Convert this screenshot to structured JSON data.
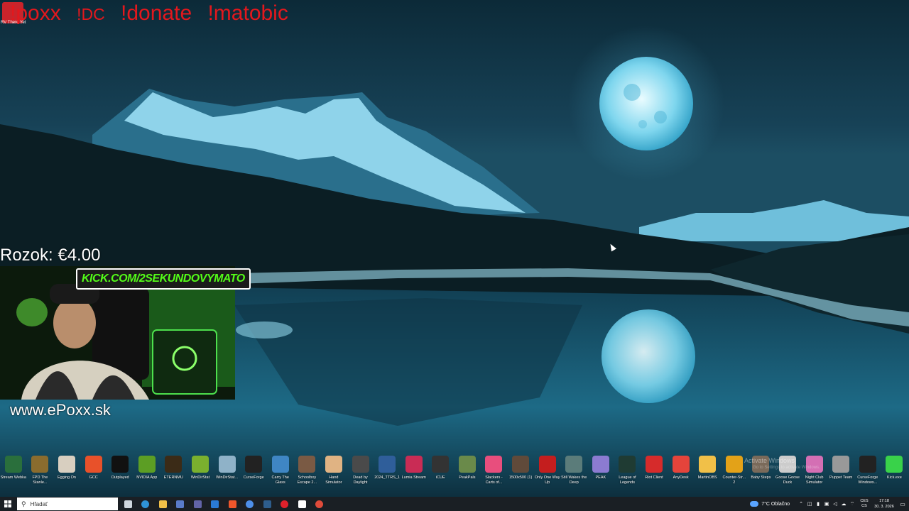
{
  "overlay": {
    "commands": [
      "!poxx",
      "!DC",
      "!donate",
      "!matobic"
    ],
    "app_caption": "RV There Yet",
    "donation": "Rozok: €4.00",
    "kick": "KICK.COM/2SEKUNDOVYMATO",
    "website": "www.ePoxx.sk"
  },
  "desktop_icons": [
    {
      "label": "Stream Webka",
      "color": "#2a6f3c"
    },
    {
      "label": "FPD The Stanle...",
      "color": "#8a6c2e"
    },
    {
      "label": "Egging On",
      "color": "#d8cfc0"
    },
    {
      "label": "GCC",
      "color": "#e8512a"
    },
    {
      "label": "Outplayed",
      "color": "#111111"
    },
    {
      "label": "NVIDIA App",
      "color": "#5c9e24"
    },
    {
      "label": "ETERNMU",
      "color": "#3b2b17"
    },
    {
      "label": "WinDirStat",
      "color": "#7ab02e"
    },
    {
      "label": "WinDirStat...",
      "color": "#8fb2c8"
    },
    {
      "label": "CurseForge",
      "color": "#222222"
    },
    {
      "label": "Carry The Glass",
      "color": "#3f86c4"
    },
    {
      "label": "Schoolboy Escape 2...",
      "color": "#7a5a44"
    },
    {
      "label": "Hand Simulator",
      "color": "#e0b383"
    },
    {
      "label": "Dead by Daylight",
      "color": "#4a4a4a"
    },
    {
      "label": "2024_TTRS_1",
      "color": "#2f5e9a"
    },
    {
      "label": "Lumia Stream",
      "color": "#c92c55"
    },
    {
      "label": "iCUE",
      "color": "#333333"
    },
    {
      "label": "PeakPals",
      "color": "#6a8a4a"
    },
    {
      "label": "Slackers - Carts of...",
      "color": "#e84e7d"
    },
    {
      "label": "1500x500 (1)",
      "color": "#604a3a"
    },
    {
      "label": "Only One Way Up",
      "color": "#c41e1e"
    },
    {
      "label": "Still Wakes the Deep",
      "color": "#5b7c7a"
    },
    {
      "label": "PEAK",
      "color": "#8c7bd1"
    },
    {
      "label": "League of Legends",
      "color": "#1f3b33"
    },
    {
      "label": "Riot Client",
      "color": "#d62b2b"
    },
    {
      "label": "AnyDesk",
      "color": "#e5443b"
    },
    {
      "label": "MartinOBS",
      "color": "#f1c048"
    },
    {
      "label": "Counter-Str... 2",
      "color": "#e3a218"
    },
    {
      "label": "Baby Steps",
      "color": "#7a6a5a"
    },
    {
      "label": "Goose Goose Duck",
      "color": "#cccccc"
    },
    {
      "label": "Night Club Simulator",
      "color": "#d46fb4"
    },
    {
      "label": "Puppet Team",
      "color": "#999999"
    },
    {
      "label": "CurseForge Windows...",
      "color": "#222222"
    },
    {
      "label": "Kick.exe",
      "color": "#39d24a"
    }
  ],
  "activate": {
    "title": "Activate Windows",
    "sub": "Go to Settings to activate Windows."
  },
  "taskbar": {
    "search_placeholder": "Hľadať",
    "apps": [
      {
        "name": "task-view",
        "color": "#cfd6dd"
      },
      {
        "name": "edge",
        "color": "#2f93d6"
      },
      {
        "name": "file-explorer",
        "color": "#f1c048"
      },
      {
        "name": "store",
        "color": "#5a7bc9"
      },
      {
        "name": "teams",
        "color": "#6264a7"
      },
      {
        "name": "mail",
        "color": "#2a7ad4"
      },
      {
        "name": "brave",
        "color": "#f0562b"
      },
      {
        "name": "app-blue",
        "color": "#4d8ee8"
      },
      {
        "name": "steam",
        "color": "#2e5d8c"
      },
      {
        "name": "opera",
        "color": "#e0212b"
      },
      {
        "name": "obs",
        "color": "#ffffff"
      },
      {
        "name": "chrome",
        "color": "#e04b3a"
      }
    ],
    "weather": "7°C  Oblačno",
    "language": [
      "CES",
      "CS"
    ],
    "time": "17:18",
    "date": "30. 3. 2026"
  }
}
